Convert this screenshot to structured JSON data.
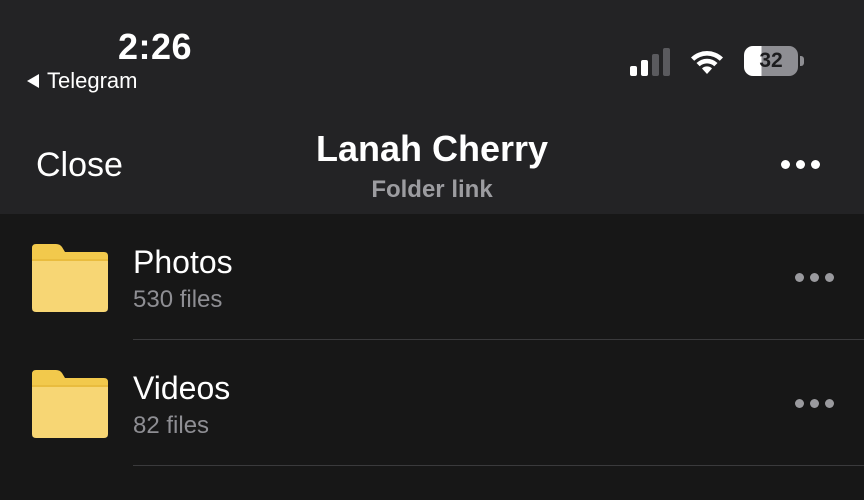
{
  "status_bar": {
    "time": "2:26",
    "back_app": "Telegram",
    "battery_level": "32",
    "icons": [
      "cellular-signal-icon",
      "wifi-icon",
      "battery-icon"
    ]
  },
  "nav": {
    "close_label": "Close",
    "title": "Lanah Cherry",
    "subtitle": "Folder link",
    "more_icon": "more-horizontal-icon"
  },
  "folders": [
    {
      "name": "Photos",
      "meta": "530 files",
      "icon": "folder-icon"
    },
    {
      "name": "Videos",
      "meta": "82 files",
      "icon": "folder-icon"
    }
  ],
  "colors": {
    "folder": "#F7D674",
    "folder_tab": "#F2C94C",
    "background": "#171717",
    "header": "#232325",
    "secondary_text": "#8e8e93"
  }
}
